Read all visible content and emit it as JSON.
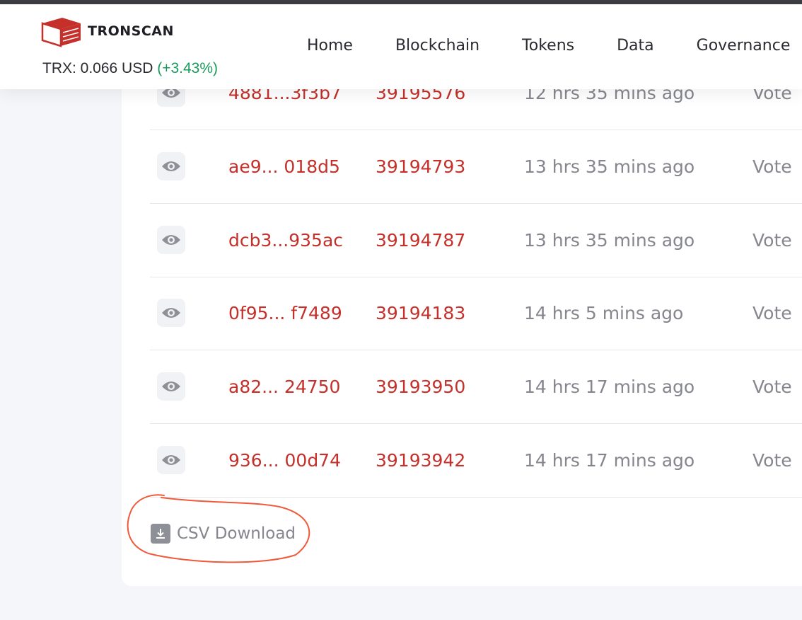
{
  "header": {
    "logo_text": "TRONSCAN",
    "price_label": "TRX: 0.066 USD ",
    "price_change": "(+3.43%)"
  },
  "nav": [
    {
      "label": "Home"
    },
    {
      "label": "Blockchain"
    },
    {
      "label": "Tokens"
    },
    {
      "label": "Data"
    },
    {
      "label": "Governance"
    }
  ],
  "rows": [
    {
      "hash": "4881...3f3b7",
      "block": "39195576",
      "age": "12 hrs 35 mins ago",
      "type": "Vote"
    },
    {
      "hash": "ae9... 018d5",
      "block": "39194793",
      "age": "13 hrs 35 mins ago",
      "type": "Vote"
    },
    {
      "hash": "dcb3...935ac",
      "block": "39194787",
      "age": "13 hrs 35 mins ago",
      "type": "Vote"
    },
    {
      "hash": "0f95... f7489",
      "block": "39194183",
      "age": "14 hrs 5 mins ago",
      "type": "Vote"
    },
    {
      "hash": "a82... 24750",
      "block": "39193950",
      "age": "14 hrs 17 mins ago",
      "type": "Vote"
    },
    {
      "hash": "936... 00d74",
      "block": "39193942",
      "age": "14 hrs 17 mins ago",
      "type": "Vote"
    }
  ],
  "csv": {
    "label": "CSV Download"
  },
  "colors": {
    "link_red": "#c5302a",
    "muted_gray": "#85868e",
    "price_green": "#1a9a5c",
    "annotation_orange": "#f0593a"
  }
}
